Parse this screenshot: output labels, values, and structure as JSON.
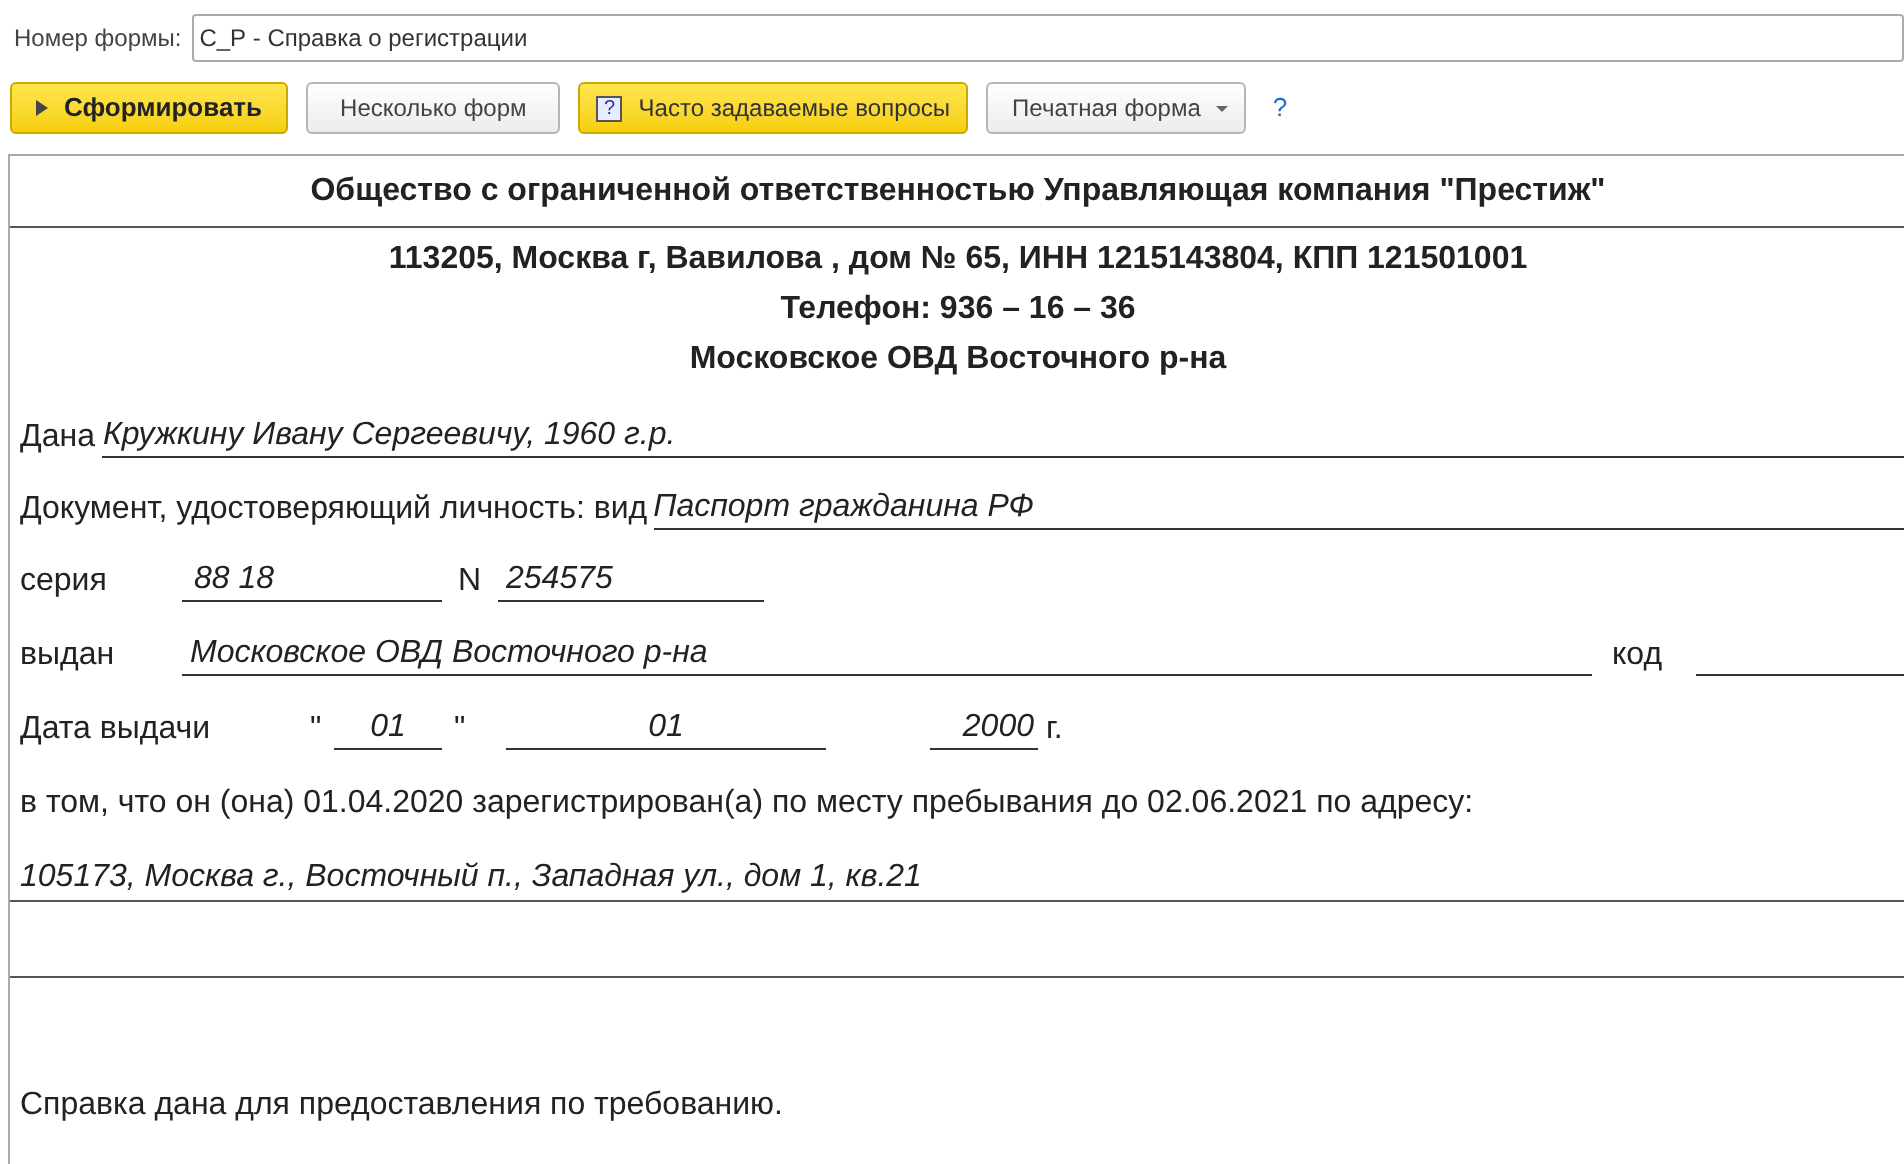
{
  "form_number": {
    "label": "Номер формы:",
    "value": "С_Р - Справка о регистрации"
  },
  "toolbar": [
    {
      "kind": "primary",
      "label": "Сформировать"
    },
    {
      "kind": "plain",
      "label": "Несколько форм"
    },
    {
      "kind": "help",
      "label": "Часто задаваемые вопросы",
      "icon_text": "?"
    },
    {
      "kind": "dropdown",
      "label": "Печатная форма"
    },
    {
      "kind": "link",
      "label": "?"
    }
  ],
  "document": {
    "organization": "Общество с ограниченной ответственностью Управляющая компания \"Престиж\"",
    "header_lines": [
      "113205, Москва г, Вавилова , дом № 65, ИНН 1215143804, КПП 121501001",
      "Телефон: 936 – 16 – 36",
      "Московское ОВД Восточного р-на"
    ],
    "issued_to": {
      "label": "Дана",
      "value": "Кружкину Ивану Сергеевичу, 1960 г.р."
    },
    "id_document": {
      "label": "Документ, удостоверяющий личность: вид",
      "value": "Паспорт гражданина РФ"
    },
    "series": {
      "label": "серия",
      "value": "88 18"
    },
    "number": {
      "label": "N",
      "value": "254575"
    },
    "issued_by": {
      "label": "выдан",
      "value": "Московское ОВД Восточного р-на"
    },
    "code": {
      "label": "код"
    },
    "issue_date": {
      "label": "Дата выдачи",
      "quote_open": "\"",
      "day": "01",
      "quote_close": "\"",
      "month": "01",
      "year": "2000",
      "year_suffix": "г."
    },
    "statement": "в том, что он (она) 01.04.2020 зарегистрирован(а) по месту пребывания до 02.06.2021 по адресу:",
    "address": "105173, Москва г., Восточный п., Западная ул., дом 1, кв.21",
    "footer": "Справка дана для предоставления по требованию."
  }
}
